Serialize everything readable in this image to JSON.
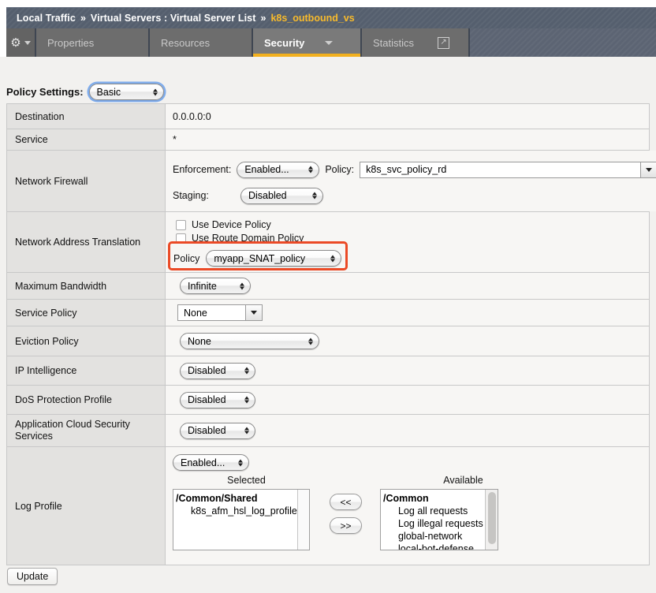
{
  "breadcrumb": {
    "segments": [
      "Local Traffic",
      "Virtual Servers : Virtual Server List"
    ],
    "separator": "»",
    "current": "k8s_outbound_vs"
  },
  "tabs": {
    "gear_icon": "gear-icon",
    "items": [
      {
        "label": "Properties",
        "active": false
      },
      {
        "label": "Resources",
        "active": false
      },
      {
        "label": "Security",
        "active": true,
        "has_caret": true
      },
      {
        "label": "Statistics",
        "active": false,
        "has_popout": true
      }
    ]
  },
  "policy_settings": {
    "label": "Policy Settings:",
    "value": "Basic"
  },
  "rows": {
    "destination": {
      "label": "Destination",
      "value": "0.0.0.0:0"
    },
    "service": {
      "label": "Service",
      "value": "*"
    },
    "network_firewall": {
      "label": "Network Firewall",
      "enforcement_label": "Enforcement:",
      "enforcement_value": "Enabled...",
      "policy_label": "Policy:",
      "policy_value": "k8s_svc_policy_rd",
      "staging_label": "Staging:",
      "staging_value": "Disabled"
    },
    "nat": {
      "label": "Network Address Translation",
      "use_device_policy": "Use Device Policy",
      "use_route_domain_policy": "Use Route Domain Policy",
      "policy_label": "Policy",
      "policy_value": "myapp_SNAT_policy",
      "highlight_color": "#eb4a26"
    },
    "max_bandwidth": {
      "label": "Maximum Bandwidth",
      "value": "Infinite"
    },
    "service_policy": {
      "label": "Service Policy",
      "value": "None"
    },
    "eviction_policy": {
      "label": "Eviction Policy",
      "value": "None"
    },
    "ip_intelligence": {
      "label": "IP Intelligence",
      "value": "Disabled"
    },
    "dos_protection": {
      "label": "DoS Protection Profile",
      "value": "Disabled"
    },
    "acss": {
      "label": "Application Cloud Security Services",
      "value": "Disabled"
    },
    "log_profile": {
      "label": "Log Profile",
      "enabled_value": "Enabled...",
      "selected_header": "Selected",
      "available_header": "Available",
      "selected_items": [
        {
          "text": "/Common/Shared",
          "group": true
        },
        {
          "text": "k8s_afm_hsl_log_profile",
          "group": false
        }
      ],
      "available_items": [
        {
          "text": "/Common",
          "group": true
        },
        {
          "text": "Log all requests",
          "group": false
        },
        {
          "text": "Log illegal requests",
          "group": false
        },
        {
          "text": "global-network",
          "group": false
        },
        {
          "text": "local-bot-defense",
          "group": false
        }
      ],
      "move_left_label": "<<",
      "move_right_label": ">>"
    }
  },
  "footer": {
    "update_label": "Update"
  }
}
